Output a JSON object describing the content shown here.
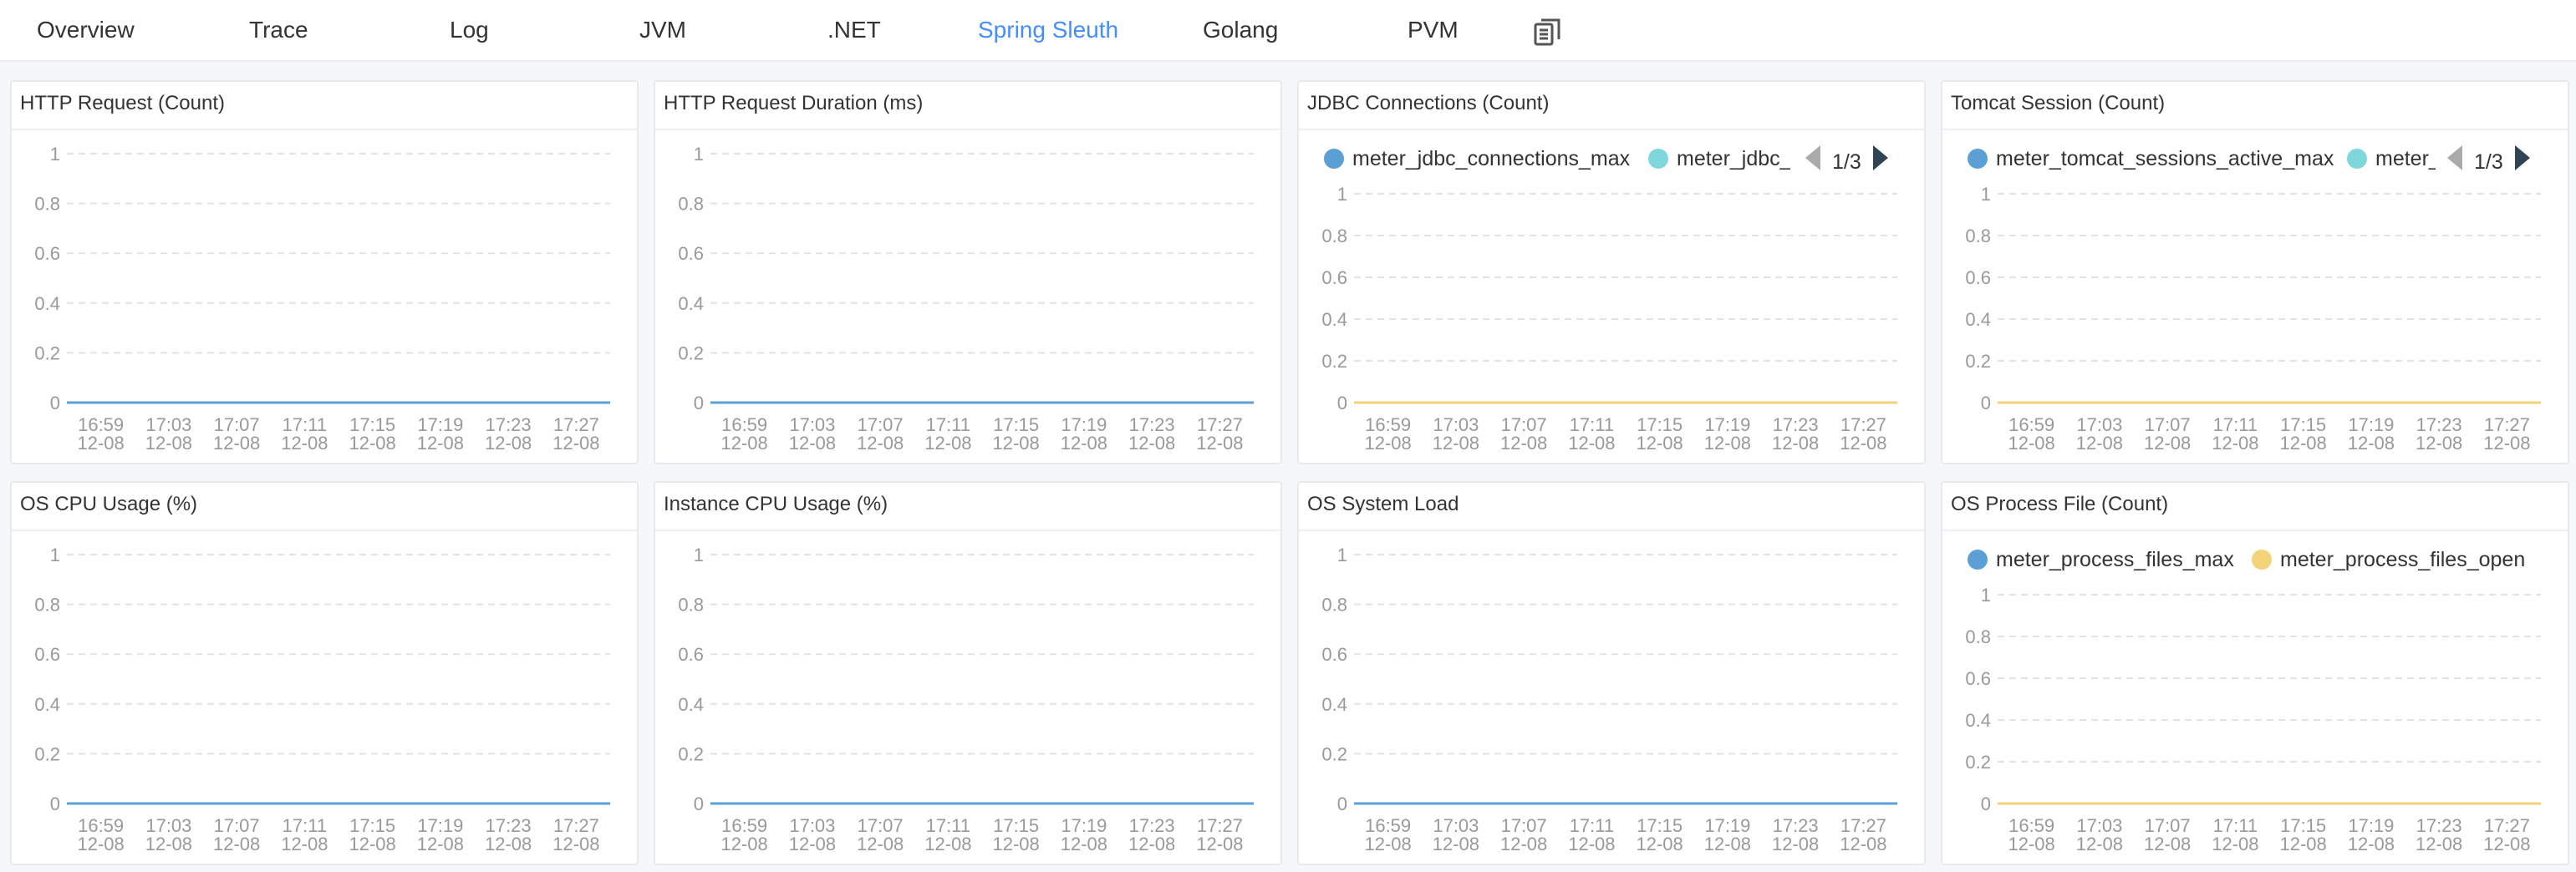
{
  "nav": {
    "tabs": [
      {
        "label": "Overview"
      },
      {
        "label": "Trace"
      },
      {
        "label": "Log"
      },
      {
        "label": "JVM"
      },
      {
        "label": ".NET"
      },
      {
        "label": "Spring Sleuth",
        "active": true
      },
      {
        "label": "Golang"
      },
      {
        "label": "PVM"
      }
    ],
    "extra_icon": "copy-icon"
  },
  "colors": {
    "active_tab": "#448dfe",
    "series_blue": "#5aa0d4",
    "series_cyan": "#7fd7dc",
    "series_yellow": "#f2d377",
    "pager_disabled": "#aaaaaa",
    "pager_enabled": "#2f4554"
  },
  "chart_data": [
    {
      "id": "http_request",
      "title": "HTTP Request (Count)",
      "type": "line",
      "x": [
        "16:59\n12-08",
        "17:03\n12-08",
        "17:07\n12-08",
        "17:11\n12-08",
        "17:15\n12-08",
        "17:19\n12-08",
        "17:23\n12-08",
        "17:27\n12-08"
      ],
      "yticks": [
        "0",
        "0.2",
        "0.4",
        "0.6",
        "0.8",
        "1"
      ],
      "ylim": [
        0,
        1
      ],
      "series": [
        {
          "color": "#5aa0d4",
          "values": [
            0,
            0,
            0,
            0,
            0,
            0,
            0,
            0
          ]
        }
      ],
      "legend": null
    },
    {
      "id": "http_duration",
      "title": "HTTP Request Duration (ms)",
      "type": "line",
      "x": [
        "16:59\n12-08",
        "17:03\n12-08",
        "17:07\n12-08",
        "17:11\n12-08",
        "17:15\n12-08",
        "17:19\n12-08",
        "17:23\n12-08",
        "17:27\n12-08"
      ],
      "yticks": [
        "0",
        "0.2",
        "0.4",
        "0.6",
        "0.8",
        "1"
      ],
      "ylim": [
        0,
        1
      ],
      "series": [
        {
          "color": "#5aa0d4",
          "values": [
            0,
            0,
            0,
            0,
            0,
            0,
            0,
            0
          ]
        }
      ],
      "legend": null
    },
    {
      "id": "jdbc",
      "title": "JDBC Connections (Count)",
      "type": "line",
      "x": [
        "16:59\n12-08",
        "17:03\n12-08",
        "17:07\n12-08",
        "17:11\n12-08",
        "17:15\n12-08",
        "17:19\n12-08",
        "17:23\n12-08",
        "17:27\n12-08"
      ],
      "yticks": [
        "0",
        "0.2",
        "0.4",
        "0.6",
        "0.8",
        "1"
      ],
      "ylim": [
        0,
        1
      ],
      "series": [
        {
          "name": "meter_jdbc_connections_max",
          "color": "#5aa0d4",
          "values": [
            0,
            0,
            0,
            0,
            0,
            0,
            0,
            0
          ]
        },
        {
          "name": "meter_jdbc_",
          "color": "#7fd7dc",
          "values": [
            0,
            0,
            0,
            0,
            0,
            0,
            0,
            0
          ]
        },
        {
          "color": "#f2d377",
          "values": [
            0,
            0,
            0,
            0,
            0,
            0,
            0,
            0
          ]
        }
      ],
      "legend": {
        "items": [
          "meter_jdbc_connections_max",
          "meter_jdbc_"
        ],
        "page": "1/3"
      }
    },
    {
      "id": "tomcat",
      "title": "Tomcat Session (Count)",
      "type": "line",
      "x": [
        "16:59\n12-08",
        "17:03\n12-08",
        "17:07\n12-08",
        "17:11\n12-08",
        "17:15\n12-08",
        "17:19\n12-08",
        "17:23\n12-08",
        "17:27\n12-08"
      ],
      "yticks": [
        "0",
        "0.2",
        "0.4",
        "0.6",
        "0.8",
        "1"
      ],
      "ylim": [
        0,
        1
      ],
      "series": [
        {
          "name": "meter_tomcat_sessions_active_max",
          "color": "#5aa0d4",
          "values": [
            0,
            0,
            0,
            0,
            0,
            0,
            0,
            0
          ]
        },
        {
          "name": "meter_",
          "color": "#7fd7dc",
          "values": [
            0,
            0,
            0,
            0,
            0,
            0,
            0,
            0
          ]
        },
        {
          "color": "#f2d377",
          "values": [
            0,
            0,
            0,
            0,
            0,
            0,
            0,
            0
          ]
        }
      ],
      "legend": {
        "items": [
          "meter_tomcat_sessions_active_max",
          "meter_"
        ],
        "page": "1/3"
      }
    },
    {
      "id": "os_cpu",
      "title": "OS CPU Usage (%)",
      "type": "line",
      "x": [
        "16:59\n12-08",
        "17:03\n12-08",
        "17:07\n12-08",
        "17:11\n12-08",
        "17:15\n12-08",
        "17:19\n12-08",
        "17:23\n12-08",
        "17:27\n12-08"
      ],
      "yticks": [
        "0",
        "0.2",
        "0.4",
        "0.6",
        "0.8",
        "1"
      ],
      "ylim": [
        0,
        1
      ],
      "series": [
        {
          "color": "#5aa0d4",
          "values": [
            0,
            0,
            0,
            0,
            0,
            0,
            0,
            0
          ]
        }
      ],
      "legend": null
    },
    {
      "id": "instance_cpu",
      "title": "Instance CPU Usage (%)",
      "type": "line",
      "x": [
        "16:59\n12-08",
        "17:03\n12-08",
        "17:07\n12-08",
        "17:11\n12-08",
        "17:15\n12-08",
        "17:19\n12-08",
        "17:23\n12-08",
        "17:27\n12-08"
      ],
      "yticks": [
        "0",
        "0.2",
        "0.4",
        "0.6",
        "0.8",
        "1"
      ],
      "ylim": [
        0,
        1
      ],
      "series": [
        {
          "color": "#5aa0d4",
          "values": [
            0,
            0,
            0,
            0,
            0,
            0,
            0,
            0
          ]
        }
      ],
      "legend": null
    },
    {
      "id": "os_load",
      "title": "OS System Load",
      "type": "line",
      "x": [
        "16:59\n12-08",
        "17:03\n12-08",
        "17:07\n12-08",
        "17:11\n12-08",
        "17:15\n12-08",
        "17:19\n12-08",
        "17:23\n12-08",
        "17:27\n12-08"
      ],
      "yticks": [
        "0",
        "0.2",
        "0.4",
        "0.6",
        "0.8",
        "1"
      ],
      "ylim": [
        0,
        1
      ],
      "series": [
        {
          "color": "#5aa0d4",
          "values": [
            0,
            0,
            0,
            0,
            0,
            0,
            0,
            0
          ]
        }
      ],
      "legend": null
    },
    {
      "id": "os_files",
      "title": "OS Process File (Count)",
      "type": "line",
      "x": [
        "16:59\n12-08",
        "17:03\n12-08",
        "17:07\n12-08",
        "17:11\n12-08",
        "17:15\n12-08",
        "17:19\n12-08",
        "17:23\n12-08",
        "17:27\n12-08"
      ],
      "yticks": [
        "0",
        "0.2",
        "0.4",
        "0.6",
        "0.8",
        "1"
      ],
      "ylim": [
        0,
        1
      ],
      "series": [
        {
          "name": "meter_process_files_max",
          "color": "#5aa0d4",
          "values": [
            0,
            0,
            0,
            0,
            0,
            0,
            0,
            0
          ]
        },
        {
          "name": "meter_process_files_open",
          "color": "#f2d377",
          "values": [
            0,
            0,
            0,
            0,
            0,
            0,
            0,
            0
          ]
        }
      ],
      "legend": {
        "items": [
          "meter_process_files_max",
          "meter_process_files_open"
        ],
        "page": null
      }
    }
  ]
}
